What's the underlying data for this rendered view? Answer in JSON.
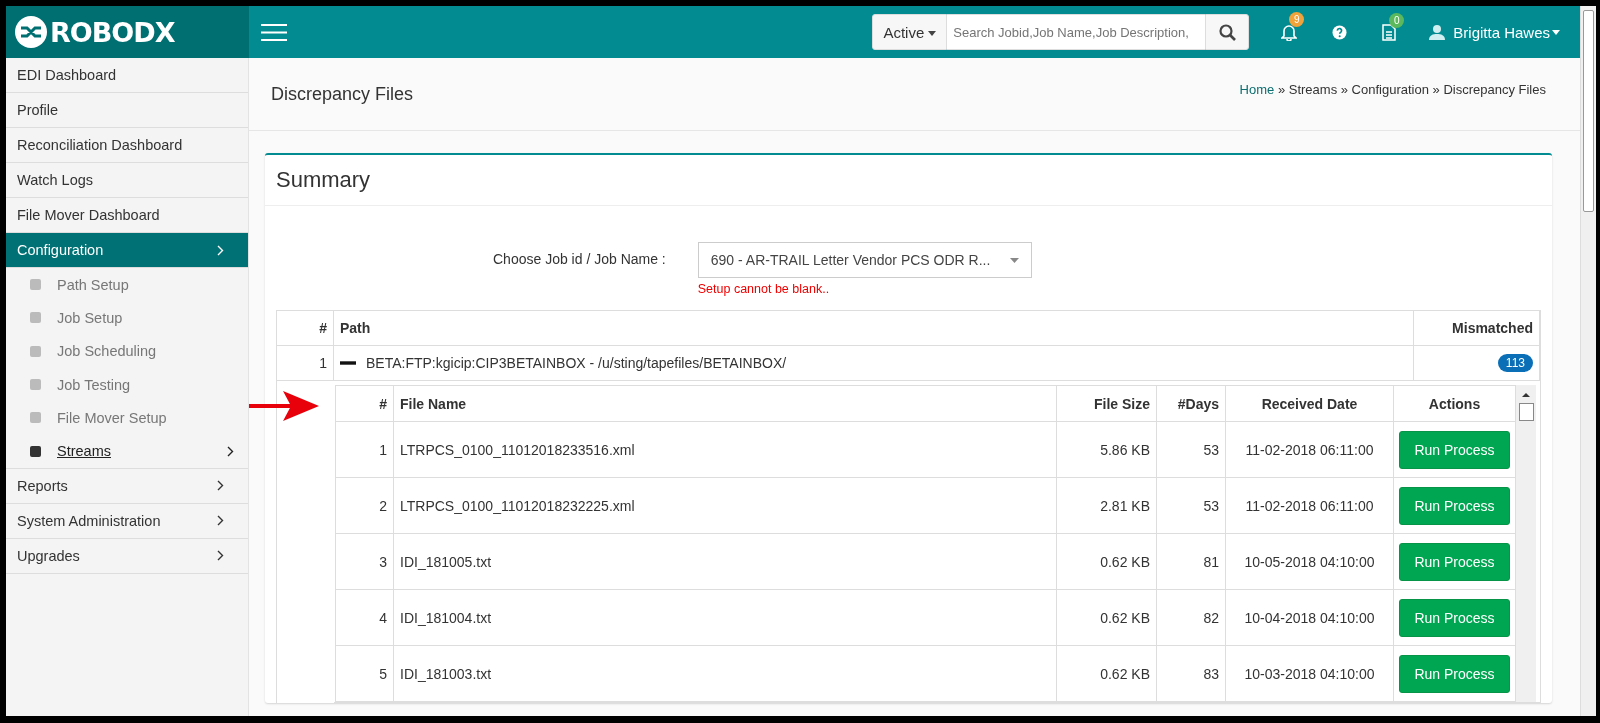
{
  "brand": "ROBODX",
  "topbar": {
    "filter": "Active",
    "search_placeholder": "Search Jobid,Job Name,Job Description,",
    "tools": [
      {
        "kind": "bell",
        "badge": "9",
        "color": "#f0a33a"
      },
      {
        "kind": "help"
      },
      {
        "kind": "document",
        "badge": "0",
        "color": "#5cb85c"
      }
    ],
    "user": "Brigitta Hawes"
  },
  "sidebar": {
    "items": [
      {
        "label": "EDI Dashboard",
        "selected": false,
        "submenu": false
      },
      {
        "label": "Profile",
        "selected": false,
        "submenu": false
      },
      {
        "label": "Reconciliation Dashboard",
        "selected": false,
        "submenu": false
      },
      {
        "label": "Watch Logs",
        "selected": false,
        "submenu": false
      },
      {
        "label": "File Mover Dashboard",
        "selected": false,
        "submenu": false
      },
      {
        "label": "Configuration",
        "selected": true,
        "submenu": true,
        "children": [
          {
            "label": "Path Setup",
            "selected": false,
            "submenu": false
          },
          {
            "label": "Job Setup",
            "selected": false,
            "submenu": false
          },
          {
            "label": "Job Scheduling",
            "selected": false,
            "submenu": false
          },
          {
            "label": "Job Testing",
            "selected": false,
            "submenu": false
          },
          {
            "label": "File Mover Setup",
            "selected": false,
            "submenu": false
          },
          {
            "label": "Streams",
            "selected": true,
            "submenu": true
          }
        ]
      },
      {
        "label": "Reports",
        "selected": false,
        "submenu": true
      },
      {
        "label": "System Administration",
        "selected": false,
        "submenu": true
      },
      {
        "label": "Upgrades",
        "selected": false,
        "submenu": true
      }
    ]
  },
  "page_title": "Discrepancy Files",
  "breadcrumb": [
    {
      "label": "Home",
      "link": true
    },
    {
      "label": "Streams",
      "link": false
    },
    {
      "label": "Configuration",
      "link": false
    },
    {
      "label": "Discrepancy Files",
      "link": false
    }
  ],
  "breadcrumb_separator": "»",
  "card": {
    "title": "Summary",
    "job_select": {
      "label": "Choose Job id / Job Name :",
      "value": "690 - AR-TRAIL Letter Vendor PCS ODR R...",
      "error": "Setup cannot be blank.."
    },
    "table": {
      "columns": [
        "#",
        "Path",
        "Mismatched"
      ],
      "rows": [
        {
          "number": "1",
          "path": "BETA:FTP:kgicip:CIP3BETAINBOX - /u/sting/tapefiles/BETAINBOX/",
          "mismatched": "113",
          "expanded": true,
          "files": {
            "columns": [
              "#",
              "File Name",
              "File Size",
              "#Days",
              "Received Date",
              "Actions"
            ],
            "rows": [
              {
                "number": "1",
                "name": "LTRPCS_0100_11012018233516.xml",
                "size": "5.86 KB",
                "days": "53",
                "received": "11-02-2018 06:11:00",
                "action": "Run Process"
              },
              {
                "number": "2",
                "name": "LTRPCS_0100_11012018232225.xml",
                "size": "2.81 KB",
                "days": "53",
                "received": "11-02-2018 06:11:00",
                "action": "Run Process"
              },
              {
                "number": "3",
                "name": "IDI_181005.txt",
                "size": "0.62 KB",
                "days": "81",
                "received": "10-05-2018 04:10:00",
                "action": "Run Process"
              },
              {
                "number": "4",
                "name": "IDI_181004.txt",
                "size": "0.62 KB",
                "days": "82",
                "received": "10-04-2018 04:10:00",
                "action": "Run Process"
              },
              {
                "number": "5",
                "name": "IDI_181003.txt",
                "size": "0.62 KB",
                "days": "83",
                "received": "10-03-2018 04:10:00",
                "action": "Run Process"
              }
            ]
          }
        }
      ]
    }
  }
}
